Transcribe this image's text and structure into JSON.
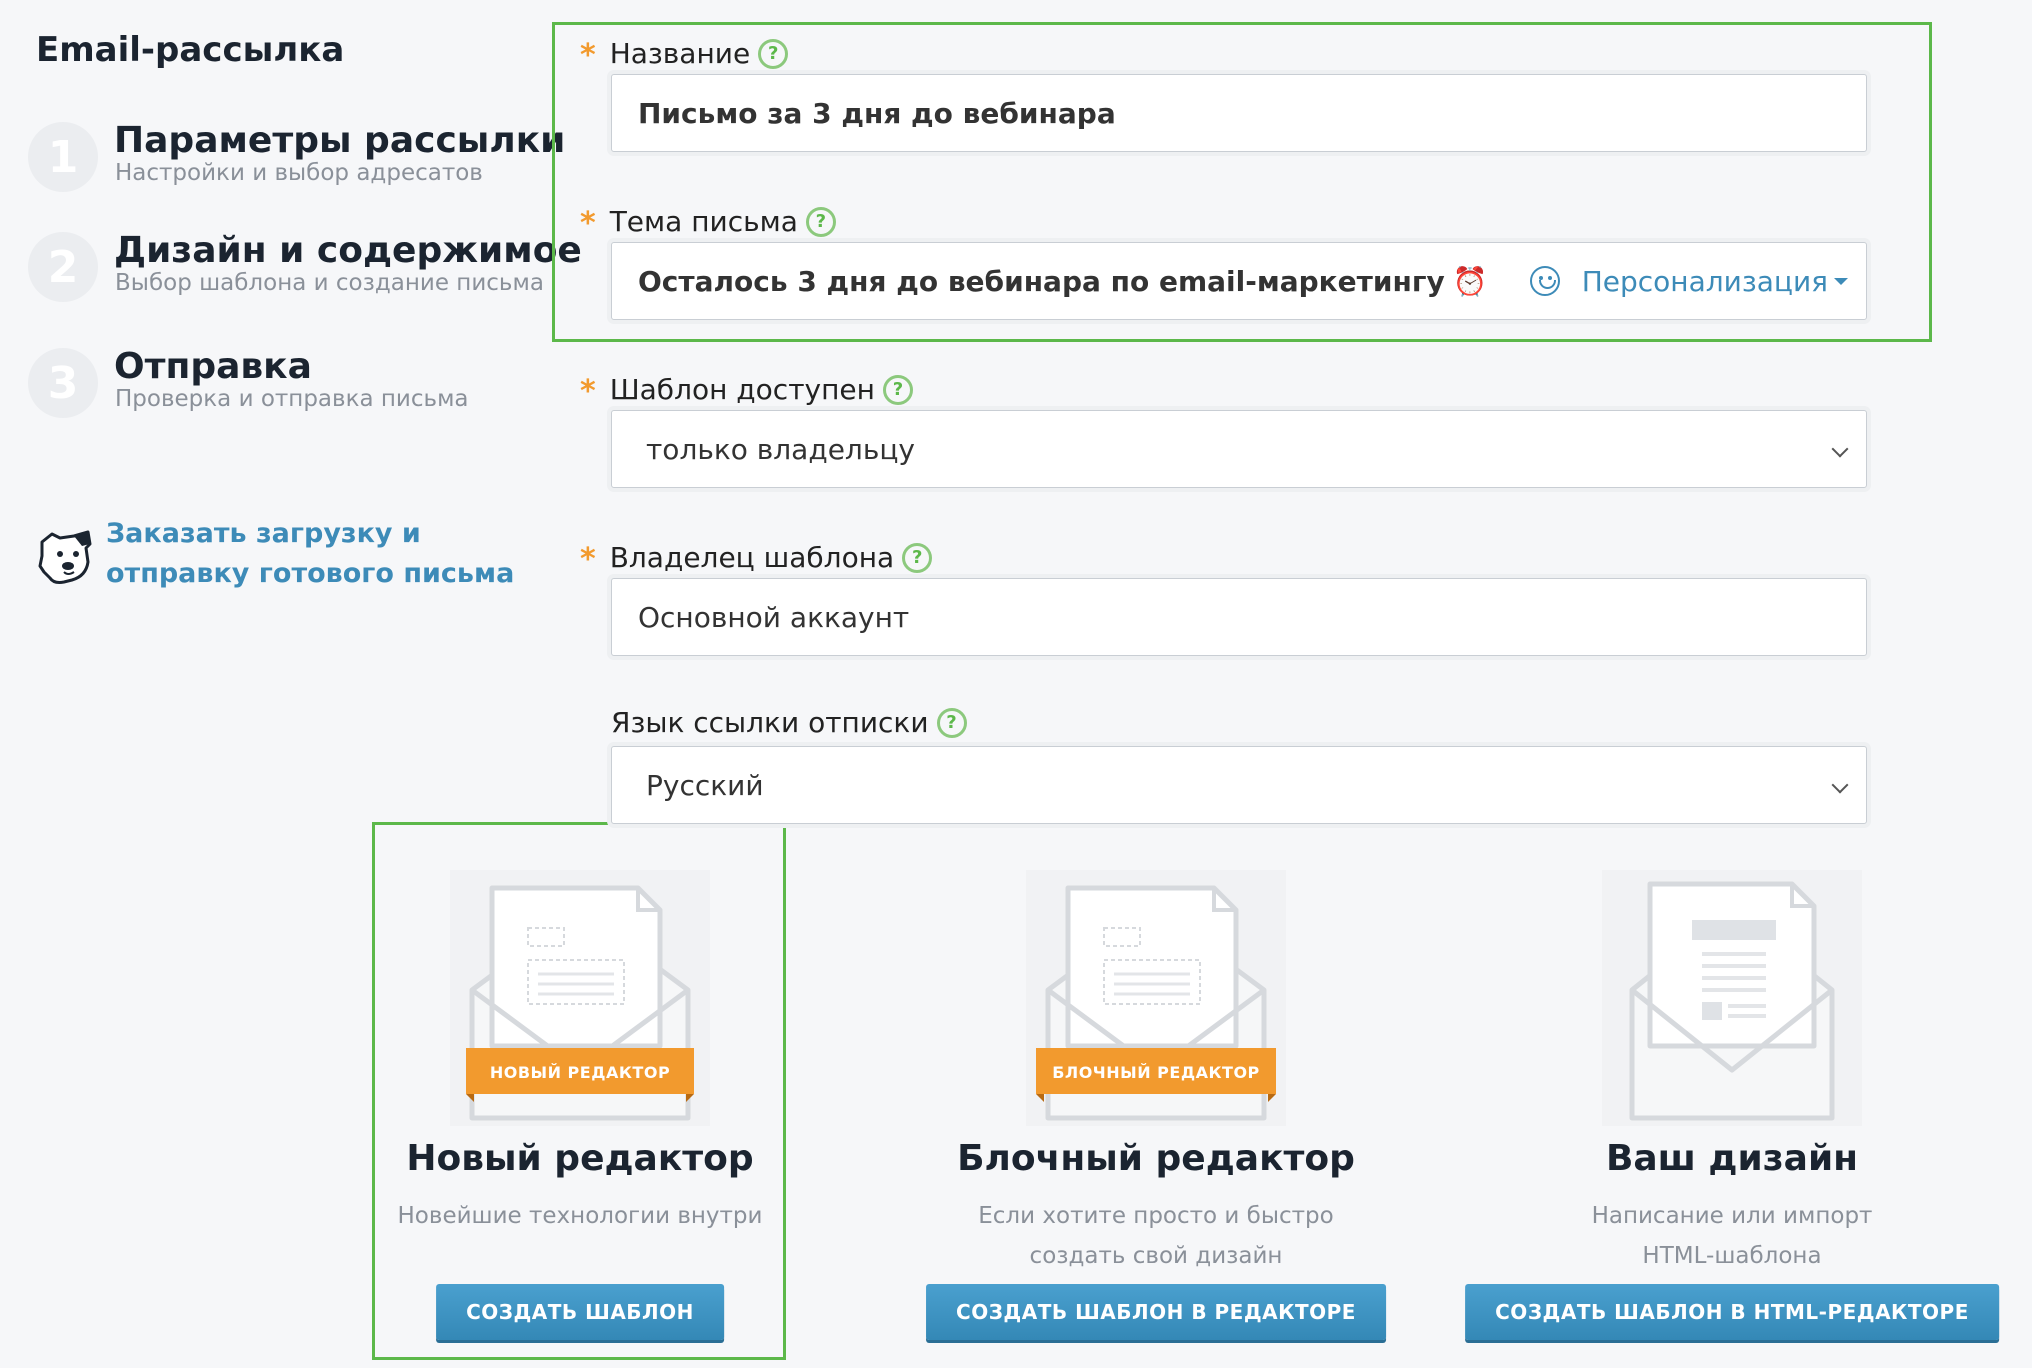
{
  "app_title": "Email-рассылка",
  "steps": [
    {
      "number": "1",
      "title": "Параметры рассылки",
      "subtitle": "Настройки и выбор адресатов"
    },
    {
      "number": "2",
      "title": "Дизайн и содержимое",
      "subtitle": "Выбор шаблона и создание письма"
    },
    {
      "number": "3",
      "title": "Отправка",
      "subtitle": "Проверка и отправка письма"
    }
  ],
  "order_link": {
    "text": "Заказать загрузку и отправку готового письма",
    "icon": "dog-mascot-icon"
  },
  "form": {
    "required_mark": "*",
    "help_mark": "?",
    "name": {
      "label": "Название",
      "value": "Письмо за 3 дня до вебинара",
      "required": true
    },
    "subject": {
      "label": "Тема письма",
      "value": "Осталось 3 дня до вебинара по email-маркетингу",
      "emoji": "⏰",
      "personalization_label": "Персонализация",
      "required": true
    },
    "template_access": {
      "label": "Шаблон доступен",
      "value": "только владельцу",
      "required": true
    },
    "template_owner": {
      "label": "Владелец шаблона",
      "value": "Основной аккаунт",
      "required": true
    },
    "unsubscribe_lang": {
      "label": "Язык ссылки отписки",
      "value": "Русский",
      "required": false
    }
  },
  "templates": [
    {
      "badge": "НОВЫЙ РЕДАКТОР",
      "title": "Новый редактор",
      "description": [
        "Новейшие технологии внутри"
      ],
      "button": "СОЗДАТЬ ШАБЛОН",
      "highlighted": true
    },
    {
      "badge": "БЛОЧНЫЙ РЕДАКТОР",
      "title": "Блочный редактор",
      "description": [
        "Если хотите просто и быстро",
        "создать свой дизайн"
      ],
      "button": "СОЗДАТЬ ШАБЛОН В РЕДАКТОРЕ",
      "highlighted": false
    },
    {
      "badge": "",
      "title": "Ваш дизайн",
      "description": [
        "Написание или импорт",
        "HTML-шаблона"
      ],
      "button": "СОЗДАТЬ ШАБЛОН В HTML-РЕДАКТОРЕ",
      "highlighted": false
    }
  ],
  "colors": {
    "accent": "#3d8bb8",
    "highlight": "#5cb84a",
    "required": "#f29a2e",
    "badge": "#f29a2e",
    "button": "#3a8fbf"
  }
}
